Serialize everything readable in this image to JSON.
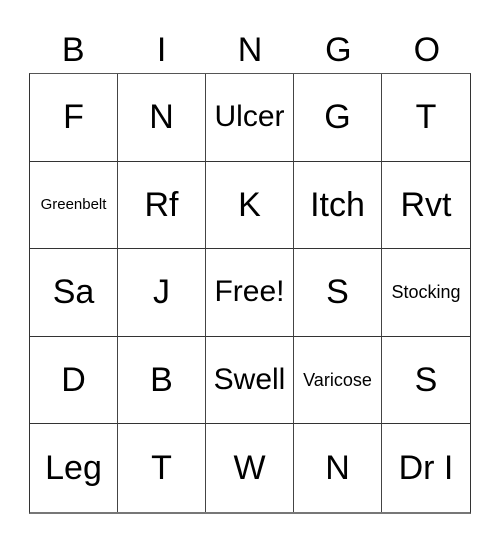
{
  "header": {
    "letters": [
      "B",
      "I",
      "N",
      "G",
      "O"
    ]
  },
  "card": {
    "rows": [
      [
        "F",
        "N",
        "Ulcer",
        "G",
        "T"
      ],
      [
        "Greenbelt",
        "Rf",
        "K",
        "Itch",
        "Rvt"
      ],
      [
        "Sa",
        "J",
        "Free!",
        "S",
        "Stocking"
      ],
      [
        "D",
        "B",
        "Swell",
        "Varicose",
        "S"
      ],
      [
        "Leg",
        "T",
        "W",
        "N",
        "Dr I"
      ]
    ]
  }
}
